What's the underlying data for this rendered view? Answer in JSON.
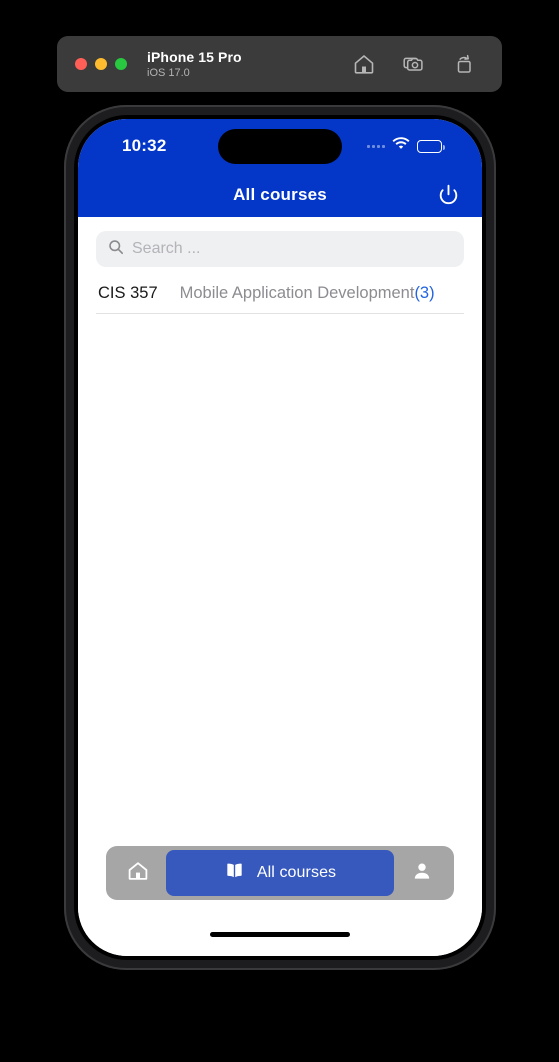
{
  "simulator": {
    "device_name": "iPhone 15 Pro",
    "os_version": "iOS 17.0",
    "window_controls": [
      "close-button",
      "minimize-button",
      "maximize-button"
    ],
    "actions": [
      {
        "name": "home-icon",
        "label": "Home"
      },
      {
        "name": "screenshot-icon",
        "label": "Screenshot"
      },
      {
        "name": "rotate-icon",
        "label": "Rotate"
      }
    ]
  },
  "status_bar": {
    "time": "10:32",
    "cellular": "cellular-icon",
    "wifi": "wifi-icon",
    "battery": "battery-icon"
  },
  "nav_bar": {
    "title": "All courses",
    "action_icon": "power-icon"
  },
  "search": {
    "placeholder": "Search ...",
    "value": "",
    "icon": "search-icon"
  },
  "courses": [
    {
      "code": "CIS 357",
      "title": "Mobile Application Development",
      "count": "(3)"
    }
  ],
  "tab_bar": {
    "items": [
      {
        "name": "tab-home",
        "icon": "home-icon",
        "label": "",
        "active": false
      },
      {
        "name": "tab-all-courses",
        "icon": "book-icon",
        "label": "All courses",
        "active": true
      },
      {
        "name": "tab-profile",
        "icon": "person-icon",
        "label": "",
        "active": false
      }
    ]
  },
  "colors": {
    "nav_blue": "#0437c8",
    "pill_blue": "#3759bd",
    "tabbar_gray": "#a6a6a6",
    "accent_link": "#2464e0",
    "search_bg": "#eff0f2"
  }
}
